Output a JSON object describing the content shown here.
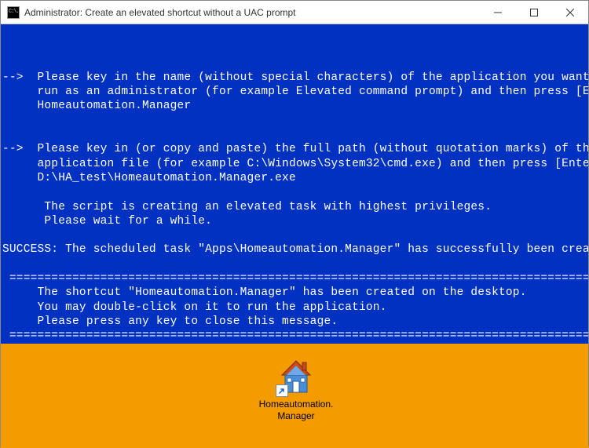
{
  "window": {
    "title": "Administrator:  Create an elevated shortcut without a UAC prompt",
    "icon_glyph": "C:\\."
  },
  "console": {
    "lines": [
      "",
      "",
      "",
      "-->  Please key in the name (without special characters) of the application you want to",
      "     run as an administrator (for example Elevated command prompt) and then press [Enter]:",
      "     Homeautomation.Manager",
      "",
      "",
      "-->  Please key in (or copy and paste) the full path (without quotation marks) of the",
      "     application file (for example C:\\Windows\\System32\\cmd.exe) and then press [Enter]:",
      "     D:\\HA_test\\Homeautomation.Manager.exe",
      "",
      "      The script is creating an elevated task with highest privileges.",
      "      Please wait for a while.",
      "",
      "SUCCESS: The scheduled task \"Apps\\Homeautomation.Manager\" has successfully been created.",
      "",
      " ==============================================================================================",
      "     The shortcut \"Homeautomation.Manager\" has been created on the desktop.",
      "     You may double-click on it to run the application.",
      "     Please press any key to close this message.",
      " =============================================================================================="
    ]
  },
  "shortcut": {
    "label": "Homeautomation.Manager",
    "icon_name": "house-icon"
  }
}
